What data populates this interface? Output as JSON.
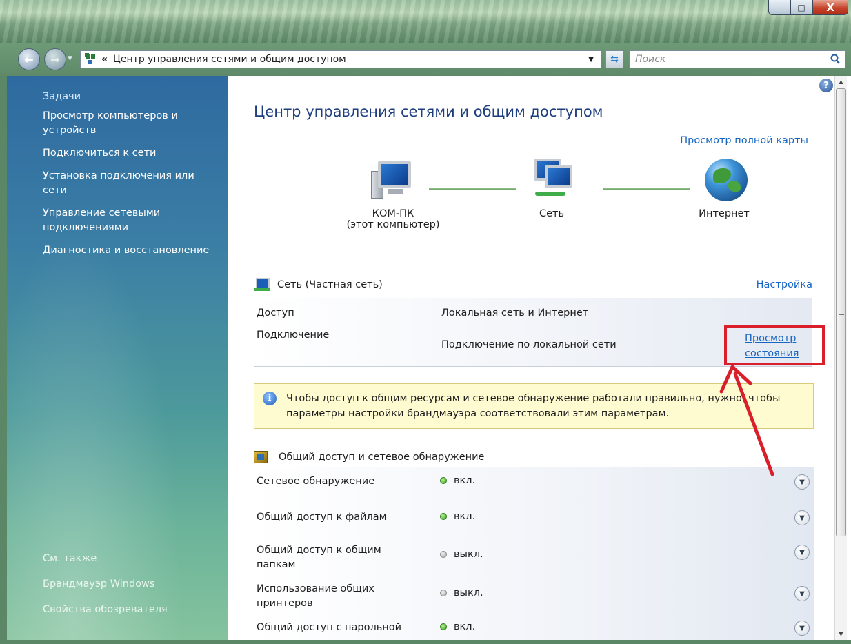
{
  "window": {
    "controls": {
      "minimize": "–",
      "maximize": "□",
      "close": "X"
    }
  },
  "address_bar": {
    "chevron": "«",
    "path": "Центр управления сетями и общим доступом",
    "search_placeholder": "Поиск"
  },
  "sidebar": {
    "heading": "Задачи",
    "tasks": [
      "Просмотр компьютеров и устройств",
      "Подключиться к сети",
      "Установка подключения или сети",
      "Управление сетевыми подключениями",
      "Диагностика и восстановление"
    ],
    "see_also_heading": "См. также",
    "see_also": [
      "Брандмауэр Windows",
      "Свойства обозревателя"
    ]
  },
  "main": {
    "title": "Центр управления сетями и общим доступом",
    "full_map_link": "Просмотр полной карты",
    "map": {
      "computer_name": "КОМ-ПК",
      "computer_sub": "(этот компьютер)",
      "network": "Сеть",
      "internet": "Интернет"
    },
    "network_section": {
      "title": "Сеть (Частная сеть)",
      "settings_link": "Настройка",
      "access_label": "Доступ",
      "access_value": "Локальная сеть и Интернет",
      "connection_label": "Подключение",
      "connection_value": "Подключение по локальной сети",
      "status_link_line1": "Просмотр",
      "status_link_line2": "состояния"
    },
    "info_message": "Чтобы доступ к общим ресурсам и сетевое обнаружение работали правильно, нужно, чтобы параметры настройки брандмауэра соответствовали этим параметрам.",
    "sharing_section": {
      "title": "Общий доступ и сетевое обнаружение",
      "rows": [
        {
          "label": "Сетевое обнаружение",
          "status": "вкл.",
          "on": true
        },
        {
          "label": "Общий доступ к файлам",
          "status": "вкл.",
          "on": true
        },
        {
          "label": "Общий доступ к общим папкам",
          "status": "выкл.",
          "on": false
        },
        {
          "label": "Использование общих принтеров",
          "status": "выкл.",
          "on": false
        },
        {
          "label": "Общий доступ с парольной",
          "status": "вкл.",
          "on": true
        }
      ]
    }
  },
  "colors": {
    "link": "#1766c2",
    "title": "#1e3e7e",
    "annotation_red": "#d9202a",
    "status_on": "#2fa41c",
    "status_off": "#a5a5a5"
  },
  "icons": {
    "nav_back": "back-arrow-icon",
    "nav_forward": "forward-arrow-icon",
    "refresh": "refresh-icon",
    "search": "search-icon",
    "help": "help-icon",
    "info": "info-icon",
    "expand": "chevron-down-icon"
  }
}
